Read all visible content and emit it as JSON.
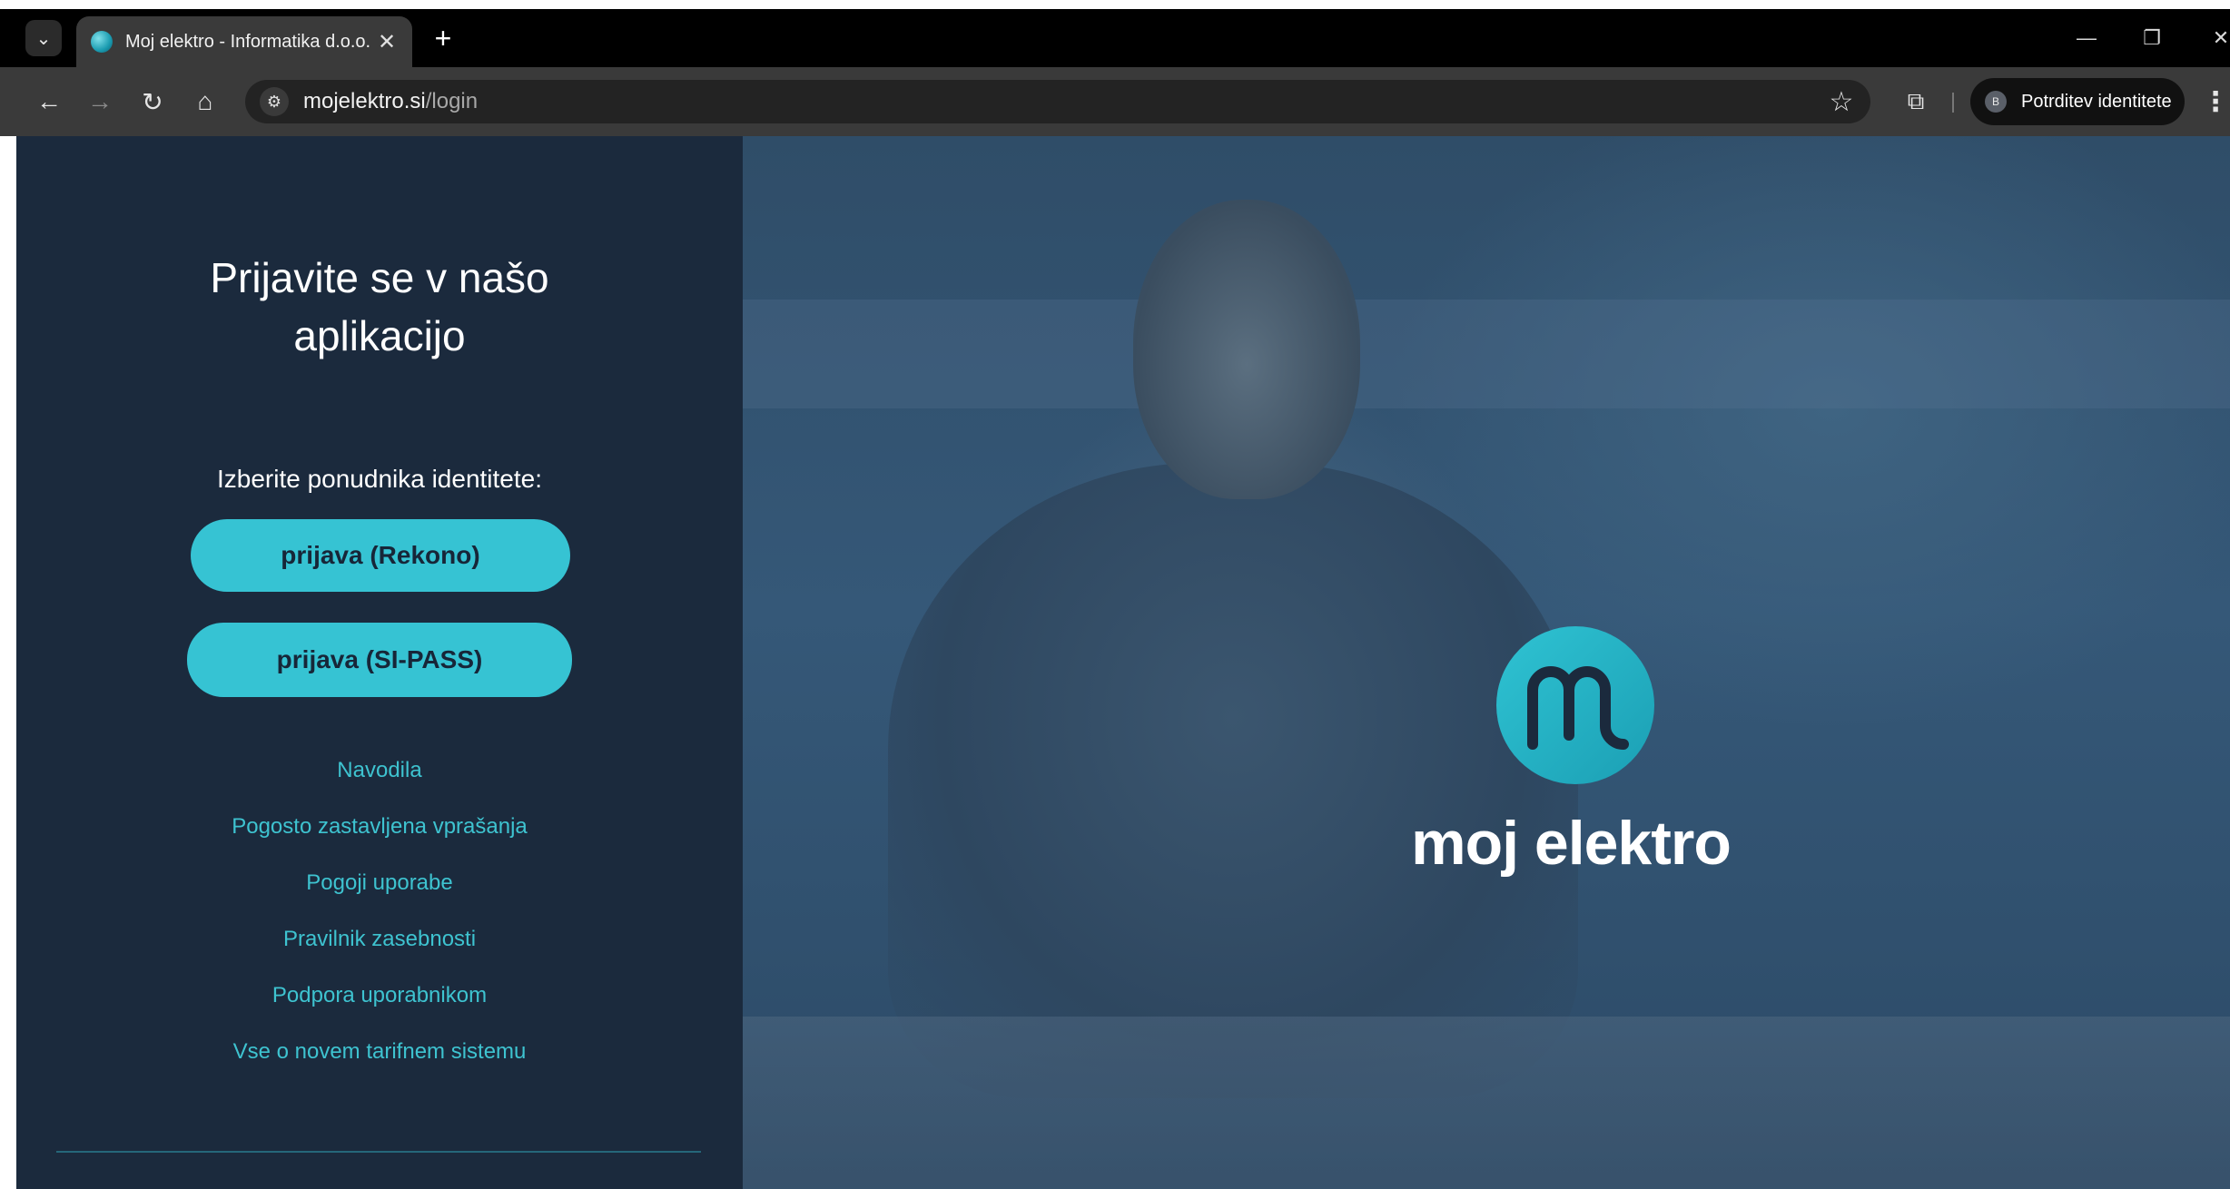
{
  "browser": {
    "tab_title": "Moj elektro - Informatika d.o.o.",
    "tab_close_glyph": "✕",
    "new_tab_glyph": "+",
    "url_host": "mojelektro.si",
    "url_path": "/login",
    "profile_initial": "B",
    "profile_label": "Potrditev identitete"
  },
  "login": {
    "heading_line1": "Prijavite se v našo",
    "heading_line2": "aplikacijo",
    "idp_prompt": "Izberite ponudnika identitete:",
    "buttons": {
      "rekono": "prijava (Rekono)",
      "sipass": "prijava (SI-PASS)"
    },
    "links": [
      "Navodila",
      "Pogosto zastavljena vprašanja",
      "Pogoji uporabe",
      "Pravilnik zasebnosti",
      "Podpora uporabnikom",
      "Vse o novem tarifnem sistemu"
    ]
  },
  "branding": {
    "wordmark": "moj elektro",
    "accent_color": "#36c3d3",
    "panel_color": "#1b2a3d"
  },
  "icons": {
    "tab_search": "chevron-down-icon",
    "back": "arrow-left-icon",
    "forward": "arrow-right-icon",
    "reload": "reload-icon",
    "home": "home-icon",
    "site_info": "tune-icon",
    "bookmark": "star-icon",
    "extensions": "puzzle-icon",
    "menu": "kebab-menu-icon"
  }
}
